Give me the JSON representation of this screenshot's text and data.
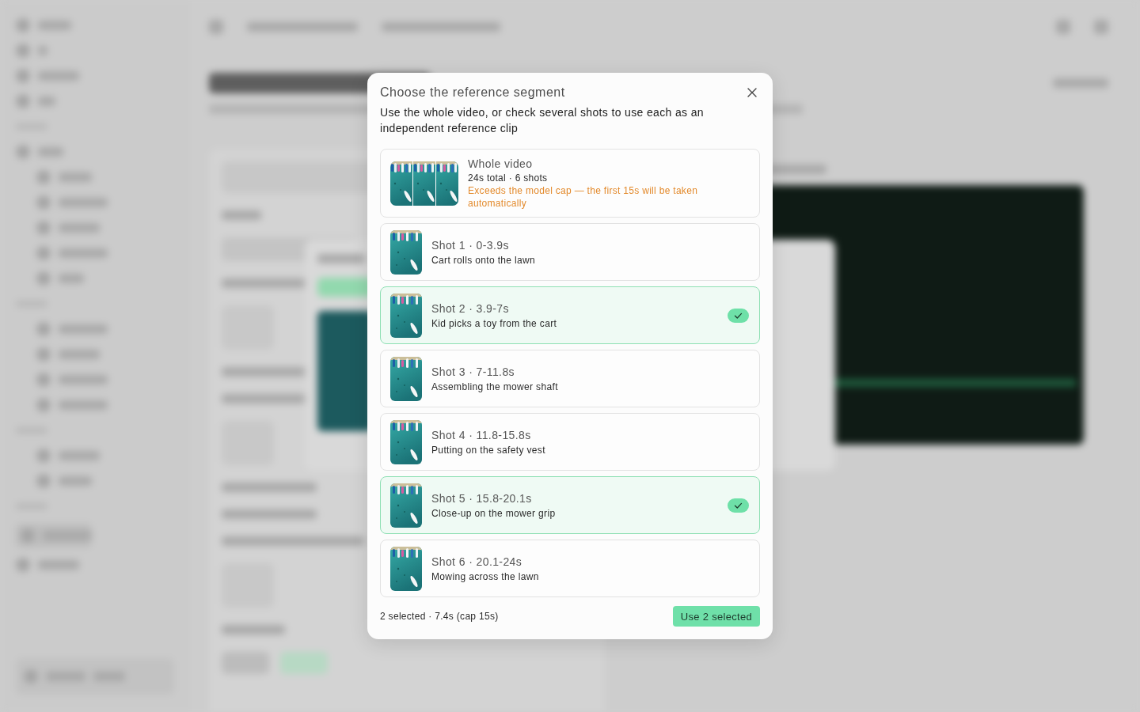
{
  "dialog": {
    "title": "Choose the reference segment",
    "description": "Use the whole video, or check several shots to use each as an independent reference clip"
  },
  "options": [
    {
      "kind": "whole",
      "title": "Whole video",
      "meta": "24s total · 6 shots",
      "warning": "Exceeds the model cap — the first 15s will be taken automatically",
      "selected": false
    },
    {
      "kind": "shot",
      "title": "Shot 1 · 0-3.9s",
      "caption": "Cart rolls onto the lawn",
      "selected": false
    },
    {
      "kind": "shot",
      "title": "Shot 2 · 3.9-7s",
      "caption": "Kid picks a toy from the cart",
      "selected": true
    },
    {
      "kind": "shot",
      "title": "Shot 3 · 7-11.8s",
      "caption": "Assembling the mower shaft",
      "selected": false
    },
    {
      "kind": "shot",
      "title": "Shot 4 · 11.8-15.8s",
      "caption": "Putting on the safety vest",
      "selected": false
    },
    {
      "kind": "shot",
      "title": "Shot 5 · 15.8-20.1s",
      "caption": "Close-up on the mower grip",
      "selected": true
    },
    {
      "kind": "shot",
      "title": "Shot 6 · 20.1-24s",
      "caption": "Mowing across the lawn",
      "selected": false
    }
  ],
  "footer": {
    "summary": "2 selected · 7.4s (cap 15s)",
    "button": "Use 2 selected"
  }
}
